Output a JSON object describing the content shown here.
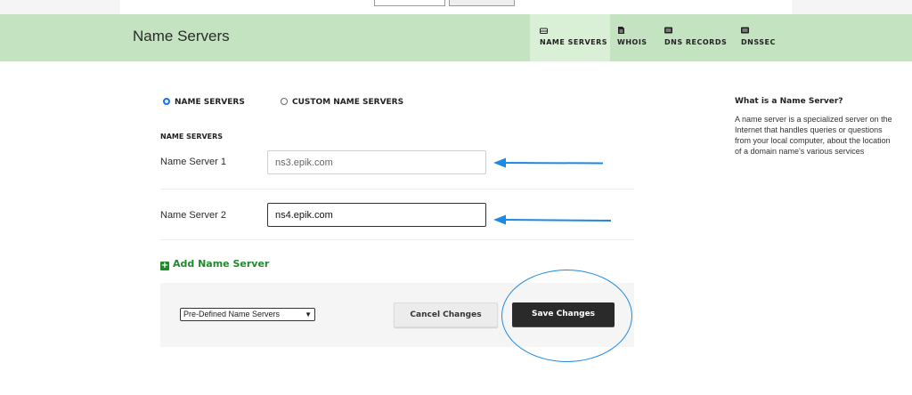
{
  "header": {
    "title": "Name Servers",
    "tabs": [
      {
        "label": "NAME SERVERS",
        "icon": "drive-icon",
        "active": true
      },
      {
        "label": "WHOIS",
        "icon": "document-icon",
        "active": false
      },
      {
        "label": "DNS RECORDS",
        "icon": "list-icon",
        "active": false
      },
      {
        "label": "DNSSEC",
        "icon": "list-icon",
        "active": false
      }
    ],
    "background": "#c4e4c1"
  },
  "mode": {
    "options": [
      {
        "label": "NAME SERVERS",
        "selected": true
      },
      {
        "label": "CUSTOM NAME SERVERS",
        "selected": false
      }
    ]
  },
  "form": {
    "section_label": "NAME SERVERS",
    "servers": [
      {
        "label": "Name Server 1",
        "value": "ns3.epik.com"
      },
      {
        "label": "Name Server 2",
        "value": "ns4.epik.com"
      }
    ],
    "add_label": "Add Name Server",
    "add_color": "#1f8a2c"
  },
  "actions": {
    "predefined_select": "Pre-Defined Name Servers",
    "cancel_label": "Cancel Changes",
    "save_label": "Save Changes"
  },
  "info": {
    "title": "What is a Name Server?",
    "body": "A name server is a specialized server on the Internet that handles queries or questions from your local computer, about the location of a domain name's various services"
  },
  "annotations": {
    "color": "#1e88e5"
  }
}
